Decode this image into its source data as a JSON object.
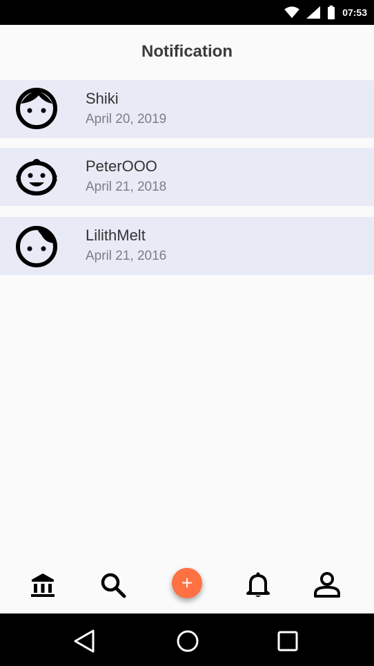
{
  "status_bar": {
    "time": "07:53",
    "icons": [
      "wifi-icon",
      "cell-signal-icon",
      "battery-icon"
    ]
  },
  "header": {
    "title": "Notification"
  },
  "notifications": [
    {
      "name": "Shiki",
      "date": "April 20, 2019",
      "avatar": "face-icon"
    },
    {
      "name": "PeterOOO",
      "date": "April 21, 2018",
      "avatar": "baby-face-icon"
    },
    {
      "name": "LilithMelt",
      "date": "April 21, 2016",
      "avatar": "face-side-hair-icon"
    }
  ],
  "bottom_nav": {
    "items": [
      "bank-icon",
      "search-icon",
      "add-icon",
      "bell-icon",
      "person-icon"
    ],
    "fab_label": "+"
  },
  "system_nav": {
    "items": [
      "back-icon",
      "home-icon",
      "recents-icon"
    ]
  },
  "colors": {
    "list_bg": "#e8eaf6",
    "fab": "#ff7043",
    "page_bg": "#fafafa"
  }
}
